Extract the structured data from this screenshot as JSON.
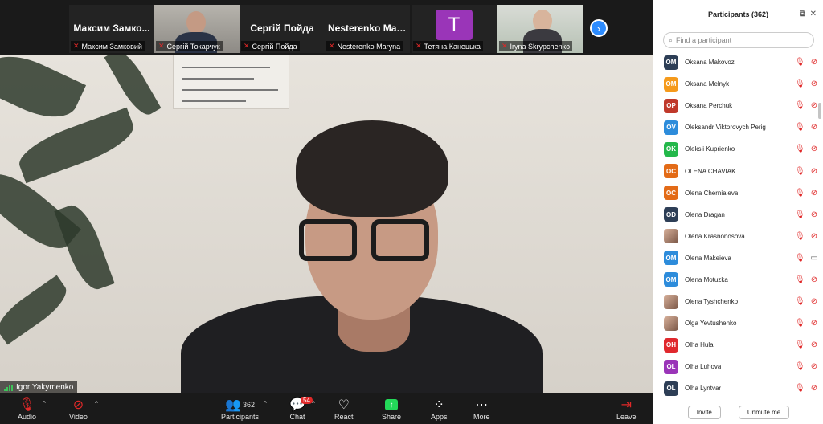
{
  "gallery": {
    "tiles": [
      {
        "name": "Максим  Замко...",
        "label": "Максим Замковий"
      },
      {
        "name": "",
        "label": "Сергій Токарчук"
      },
      {
        "name": "Сергій Пойда",
        "label": "Сергій Пойда"
      },
      {
        "name": "Nesterenko  Mar...",
        "label": "Nesterenko Maryna"
      },
      {
        "name": "",
        "avatar": "T",
        "label": "Тетяна Канецька"
      },
      {
        "name": "",
        "label": "Iryna Skrypchenko"
      }
    ],
    "next_icon": "chevron-right-icon"
  },
  "main_video": {
    "speaker_label": "Igor Yakymenko"
  },
  "toolbar": {
    "audio": "Audio",
    "video": "Video",
    "participants": "Participants",
    "participants_count": "362",
    "chat": "Chat",
    "chat_badge": "54",
    "react": "React",
    "share": "Share",
    "apps": "Apps",
    "more": "More",
    "leave": "Leave"
  },
  "panel": {
    "title": "Participants (362)",
    "search_placeholder": "Find a participant",
    "invite": "Invite",
    "unmute_me": "Unmute me",
    "participants": [
      {
        "initials": "OM",
        "name": "Oksana Makovoz",
        "color": "#2d3e56",
        "video": "off"
      },
      {
        "initials": "OM",
        "name": "Oksana Melnyk",
        "color": "#f59a1b",
        "video": "off"
      },
      {
        "initials": "OP",
        "name": "Oksana Perchuk",
        "color": "#c0392b",
        "video": "off"
      },
      {
        "initials": "OV",
        "name": "Oleksandr Viktorovych Perig",
        "color": "#2d8cdb",
        "video": "off"
      },
      {
        "initials": "OK",
        "name": "Oleksii Kuprienko",
        "color": "#23b84a",
        "video": "off"
      },
      {
        "initials": "OC",
        "name": "OLENA CHAVIAK",
        "color": "#e36b17",
        "video": "off"
      },
      {
        "initials": "OC",
        "name": "Olena Cherniaieva",
        "color": "#e36b17",
        "video": "off"
      },
      {
        "initials": "OD",
        "name": "Olena Dragan",
        "color": "#2d3e56",
        "video": "off"
      },
      {
        "initials": "",
        "name": "Olena Krasnonosova",
        "color": "photo",
        "video": "off"
      },
      {
        "initials": "OM",
        "name": "Olena Makeieva",
        "color": "#2d8cdb",
        "video": "on"
      },
      {
        "initials": "OM",
        "name": "Olena Motuzka",
        "color": "#2d8cdb",
        "video": "off"
      },
      {
        "initials": "",
        "name": "Olena Tyshchenko",
        "color": "photo",
        "video": "off"
      },
      {
        "initials": "",
        "name": "Olga Yevtushenko",
        "color": "photo",
        "video": "off"
      },
      {
        "initials": "OH",
        "name": "Olha Hulai",
        "color": "#e0282d",
        "video": "off"
      },
      {
        "initials": "OL",
        "name": "Olha Luhova",
        "color": "#9a35b8",
        "video": "off"
      },
      {
        "initials": "OL",
        "name": "Olha Lyntvar",
        "color": "#2d3e56",
        "video": "off"
      }
    ]
  }
}
